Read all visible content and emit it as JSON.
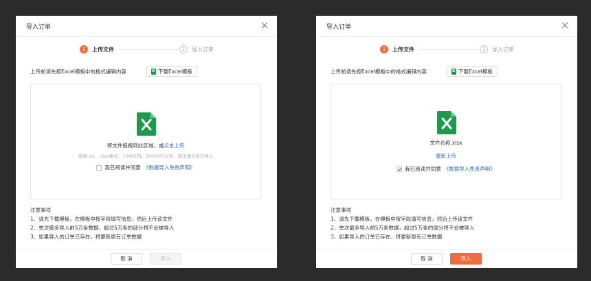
{
  "colors": {
    "accent": "#f26b3c",
    "link": "#2f6fc6",
    "excel_green": "#1d9a4c",
    "backdrop": "#2b2b2b"
  },
  "left": {
    "title": "导入订单",
    "step1_num": "1",
    "step1_label": "上传文件",
    "step2_num": "2",
    "step2_label": "导入订单",
    "hint": "上传前请先按Excel模板中的格式编辑内容",
    "download_label": "下载Excel模板",
    "drop_text": "将文件拖拽到此区域，或",
    "drop_link": "点击上传",
    "drop_sub": "支持.xls、.xlsx格式，10M以内，50000行以内，超出请分多次导入",
    "agree_text": "我已阅读并同意",
    "agree_link": "《数据导入免责声明》",
    "agree_checked": false,
    "notes": [
      "注意事项",
      "1、请先下载模板，在模板中按字段填写信息，然后上传该文件",
      "2、单次最多导入前5万条数据，超过5万条的部分将不会被导入",
      "3、如果导入的订单已存在，将更新原有订单数据"
    ],
    "cancel_label": "取 消",
    "import_label": "导入",
    "import_enabled": false
  },
  "right": {
    "title": "导入订单",
    "step1_num": "1",
    "step1_label": "上传文件",
    "step2_num": "2",
    "step2_label": "导入订单",
    "hint": "上传前请先按Excel模板中的格式编辑内容",
    "download_label": "下载Excel模板",
    "file_name": "文件名称.xlsx",
    "reupload": "重新上传",
    "agree_text": "我已阅读并同意",
    "agree_link": "《数据导入免责声明》",
    "agree_checked": true,
    "notes": [
      "注意事项",
      "1、请先下载模板，在模板中按字段填写信息，然后上传该文件",
      "2、单次最多导入前5万条数据，超过5万条的部分将不会被导入",
      "3、如果导入的订单已存在，将更新原有订单数据"
    ],
    "cancel_label": "取 消",
    "import_label": "导入",
    "import_enabled": true
  }
}
